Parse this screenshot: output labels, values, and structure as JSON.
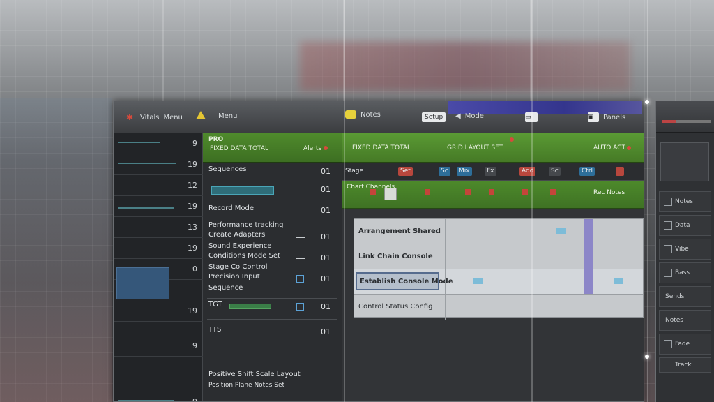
{
  "titlebar": {
    "left_label": "Vitals",
    "left_sub": "Menu",
    "center_label": "Notes",
    "right_label_1": "Setup",
    "right_label_2": "Mode",
    "right_label_3": "Panels"
  },
  "sidebar": {
    "numbers": [
      "9",
      "19",
      "12",
      "19",
      "13",
      "19",
      "0",
      "19",
      "9",
      "9"
    ]
  },
  "list_panel": {
    "header_title": "PRO",
    "header_sub": "FIXED DATA TOTAL",
    "header_right": "Alerts",
    "items": [
      {
        "label": "Sequences",
        "value": "01"
      },
      {
        "label": "",
        "value": "01"
      },
      {
        "label": "Record Mode",
        "value": "01"
      },
      {
        "label": "Performance tracking",
        "value": "01"
      },
      {
        "label": "Create Adapters",
        "value": "01"
      },
      {
        "label": "Sound Experience",
        "value": "01"
      },
      {
        "label": "Conditions Mode Set",
        "value": "01"
      },
      {
        "label": "Stage Co Control",
        "value": "01"
      },
      {
        "label": "Precision Input",
        "value": "01"
      },
      {
        "label": "Sequence",
        "value": "01"
      },
      {
        "label": "TGT",
        "value": "01"
      },
      {
        "label": "TTS",
        "value": "01"
      }
    ],
    "footer_line_1": "Positive Shift Scale Layout",
    "footer_line_2": "Position Plane Notes Set"
  },
  "grid_area": {
    "header_left": "FIXED DATA TOTAL",
    "header_mid": "GRID LAYOUT SET",
    "header_right": "AUTO ACT",
    "toolbar_label": "Stage",
    "toolbar_buttons": [
      "Set",
      "Sc",
      "Mix",
      "Fx",
      "Add",
      "Sc",
      "Ctrl"
    ],
    "green2_left": "Chart Channels",
    "green2_right": "Rec Notes",
    "rows": [
      {
        "label": "Arrangement Shared"
      },
      {
        "label": "Link Chain Console"
      },
      {
        "label": "Establish Console Mode"
      },
      {
        "label": "Control Status Config"
      }
    ]
  },
  "dock": {
    "rows": [
      "Notes",
      "Data",
      "Vibe",
      "Bass",
      "Sends",
      "Notes",
      "Fade",
      "Track"
    ]
  },
  "colors": {
    "accent_green": "#4d8a2b",
    "accent_purple": "#4a4aa8",
    "accent_red": "#d64a3c",
    "accent_cyan": "#2d6e99"
  }
}
